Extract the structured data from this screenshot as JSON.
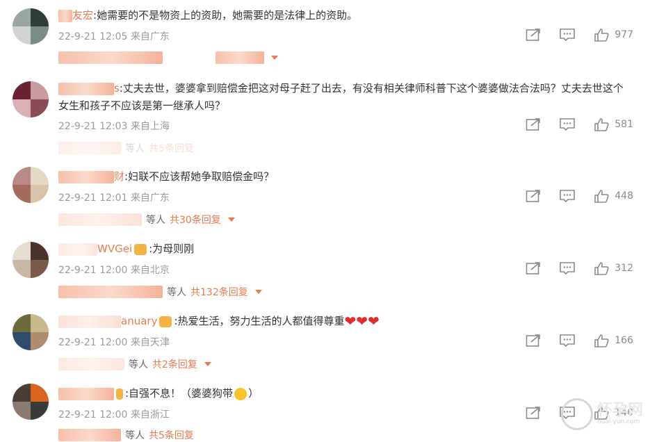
{
  "comments": [
    {
      "user": "友宏",
      "text": ":她需要的不是物资上的资助，她需要的是法律上的资助。",
      "time": "22-9-21 12:05",
      "location": "来自广东",
      "likes": "977",
      "replies_label": "",
      "replies_count": "",
      "avatar_colors": [
        "#9aa6a0",
        "#2f3d3a",
        "#cfd4d2",
        "#7a8c86"
      ]
    },
    {
      "user": "s",
      "text": ":丈夫去世，婆婆拿到赔偿金把这对母子赶了出去，有没有相关律师科普下这个婆婆做法合法吗？丈夫去世这个女生和孩子不应该是第一继承人吗？",
      "time": "22-9-21 12:03",
      "location": "来自上海",
      "likes": "581",
      "replies_label": "等人",
      "replies_count": "共5条回复",
      "avatar_colors": [
        "#6b2233",
        "#c79aa0",
        "#d9b1b5",
        "#8b4c58"
      ]
    },
    {
      "user": "财",
      "text": ":妇联不应该帮她争取赔偿金吗？",
      "time": "22-9-21 12:01",
      "location": "来自广东",
      "likes": "448",
      "replies_label": "等人",
      "replies_count": "共30条回复",
      "avatar_colors": [
        "#b88a86",
        "#e5d9c5",
        "#a36b5c",
        "#d9c2a8"
      ]
    },
    {
      "user": "WVGei",
      "text": ":为母则刚",
      "time": "22-9-21 12:00",
      "location": "来自北京",
      "likes": "312",
      "replies_label": "等人",
      "replies_count": "共132条回复",
      "avatar_colors": [
        "#e6ded3",
        "#4a332c",
        "#c9b8a6",
        "#7b5a4a"
      ]
    },
    {
      "user": "anuary",
      "text": ":热爱生活，努力生活的人都值得尊重",
      "time": "22-9-21 12:00",
      "location": "来自天津",
      "likes": "166",
      "replies_label": "等人",
      "replies_count": "共2条回复",
      "avatar_colors": [
        "#6f6a3b",
        "#c7b98a",
        "#2f4a6a",
        "#b08b6e"
      ]
    },
    {
      "user": "",
      "text": ":自强不息！（婆婆狗带",
      "text_tail": "）",
      "time": "22-9-21 12:00",
      "location": "来自浙江",
      "likes": "140",
      "replies_label": "等人",
      "replies_count": "共5条回复",
      "avatar_colors": [
        "#4a3d35",
        "#d8661e",
        "#8a7a72",
        "#3a3a38"
      ]
    }
  ],
  "icons": {
    "share": "share-icon",
    "comment": "comment-icon",
    "like": "thumbs-up-icon"
  },
  "accent": "#ea7a4c",
  "watermark": {
    "title": "怀孕网",
    "sub": "huai-yun.com"
  }
}
